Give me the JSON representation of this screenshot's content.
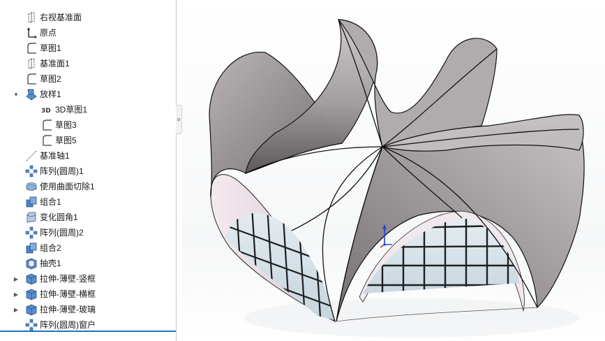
{
  "feature_tree": {
    "items": [
      {
        "label": "右视基准面",
        "icon": "plane-icon",
        "caret": ""
      },
      {
        "label": "原点",
        "icon": "origin-icon",
        "caret": ""
      },
      {
        "label": "草图1",
        "icon": "sketch-icon",
        "caret": ""
      },
      {
        "label": "基准面1",
        "icon": "plane-icon",
        "caret": ""
      },
      {
        "label": "草图2",
        "icon": "sketch-icon",
        "caret": ""
      },
      {
        "label": "放样1",
        "icon": "loft-icon",
        "caret": "▼"
      },
      {
        "label": "3D草图1",
        "icon": "sketch3d-icon",
        "caret": ""
      },
      {
        "label": "草图3",
        "icon": "sketch-icon",
        "caret": ""
      },
      {
        "label": "草图5",
        "icon": "sketch-icon",
        "caret": ""
      },
      {
        "label": "基准轴1",
        "icon": "axis-icon",
        "caret": ""
      },
      {
        "label": "阵列(圆周)1",
        "icon": "pattern-icon",
        "caret": ""
      },
      {
        "label": "使用曲面切除1",
        "icon": "surface-cut-icon",
        "caret": ""
      },
      {
        "label": "组合1",
        "icon": "combine-icon",
        "caret": ""
      },
      {
        "label": "变化圆角1",
        "icon": "fillet-icon",
        "caret": ""
      },
      {
        "label": "阵列(圆周)2",
        "icon": "pattern-icon",
        "caret": ""
      },
      {
        "label": "组合2",
        "icon": "combine-icon",
        "caret": ""
      },
      {
        "label": "抽壳1",
        "icon": "shell-icon",
        "caret": ""
      },
      {
        "label": "拉伸-薄壁-竖框",
        "icon": "extrude-icon",
        "caret": "▶"
      },
      {
        "label": "拉伸-薄壁-横框",
        "icon": "extrude-icon",
        "caret": "▶"
      },
      {
        "label": "拉伸-薄壁-玻璃",
        "icon": "extrude-icon",
        "caret": "▶"
      },
      {
        "label": "阵列(圆周)窗户",
        "icon": "pattern-icon",
        "caret": ""
      }
    ]
  },
  "viewport": {
    "model": "canopy-roof-model"
  },
  "colors": {
    "selection": "#1f73c8",
    "roof_top": "#a9a5a7",
    "roof_under": "#efe4ea",
    "glass": "#dde8ef",
    "frame": "#1e1e1e",
    "triad_y": "#1f3fd6",
    "triad_z": "#cc2222"
  }
}
